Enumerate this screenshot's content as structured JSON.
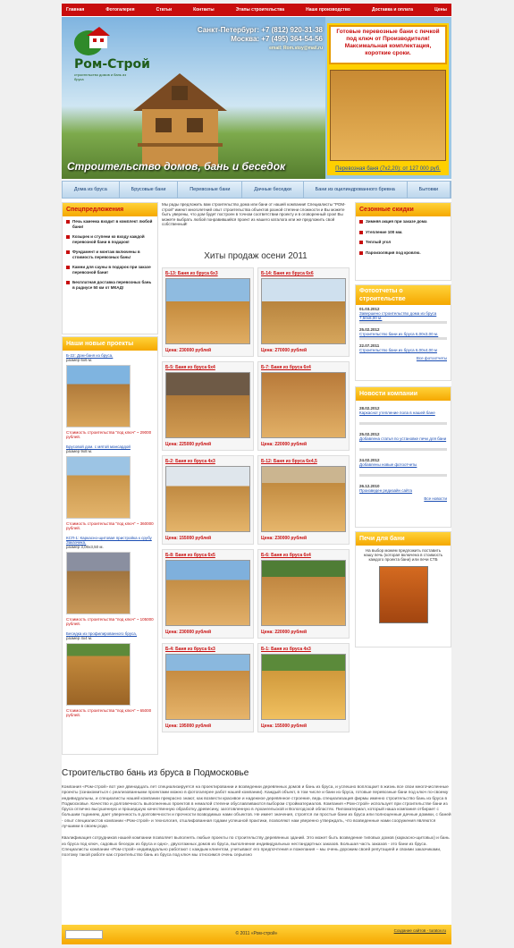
{
  "nav": [
    "Главная",
    "Фотогалерея",
    "Статьи",
    "Контакты",
    "Этапы строительства",
    "Наше производство",
    "Доставка и оплата",
    "Цены"
  ],
  "logo": {
    "title": "Ром-Строй",
    "subtitle": "строительство домов и бань из бруса"
  },
  "contacts": {
    "spb": "Санкт-Петербург: +7 (812) 920-31-38",
    "msk": "Москва: +7 (495) 364-54-56",
    "email": "email: Rom.stoy@mail.ru"
  },
  "slogan": "Строительство домов, бань и беседок",
  "promo": {
    "text": "Готовые перевозные бани с печкой под ключ от Производителя!Максимальная комплектация, короткие сроки.",
    "caption": "Перевозная баня (7x2,20): от 127 000 руб."
  },
  "categories": [
    "Дома из бруса",
    "Брусовые бани",
    "Перевозные бани",
    "Дачные беседки",
    "Бани из оцилиндрованного бревна",
    "Бытовки"
  ],
  "offers": {
    "title": "Спецпредложения",
    "items": [
      "Печь каменка входит в комплект любой бани!",
      "Козырек и ступени ко входу каждой перевозной бани в подарок!",
      "Фундамент и монтаж включены в стоимость перевозных бань!",
      "Камни для сауны в подарок при заказе перевозной бани!",
      "Бесплатная доставка перевозных бань в радиусе 50 км от МКАД!"
    ]
  },
  "projects": {
    "title": "Наши новые проекты",
    "items": [
      {
        "name": "Б-22: Дом-баня из бруса,",
        "size": "размер 6х6 м.",
        "cost": "Стоимость строительства \"под ключ\" ~ 29000 рублей."
      },
      {
        "name": "Брусовой дом. с мятой мансардой",
        "size": "размер 9х8 м.",
        "cost": "Стоимость строительства \"под ключ\" ~ 360000 рублей."
      },
      {
        "name": "КСП-1: Каркасно-щитовая пристройка к срубу Заказчика,",
        "size": "размер 3,00х3,50 м.",
        "cost": "Стоимость строительства \"под ключ\" ~ 105000 рублей."
      },
      {
        "name": "Беседка из профилированного бруса,",
        "size": "размер 4х4 м.",
        "cost": "Стоимость строительства \"под ключ\" ~ 65000 рублей."
      }
    ]
  },
  "intro": "Мы рады предложить вам строительство дома или бани от нашей компании! Специалисты \"РОМ-строй\" имеют многолетний опыт строительства объектов разной степени сложности и Вы можете быть уверены, что дом будет построен в точном соответствии проекту и в оговоренный срок! Вы можете выбрать любой понравившийся проект из нашего каталога или же предложить свой собственный!",
  "sale": {
    "title": "Хиты продаж осени 2011",
    "cards": [
      {
        "title": "Б-13: Баня из бруса 6х3",
        "price": "Цена: 230000 рублей"
      },
      {
        "title": "Б-14: Баня из бруса 6х6",
        "price": "Цена: 270000 рублей"
      },
      {
        "title": "Б-5: Баня из бруса 6х4",
        "price": "Цена: 225000 рублей"
      },
      {
        "title": "Б-7: Баня из бруса 6х4",
        "price": "Цена: 220000 рублей"
      },
      {
        "title": "Б-2: Баня из бруса 4х3",
        "price": "Цена: 155000 рублей"
      },
      {
        "title": "Б-12: Баня из бруса 6х4,5",
        "price": "Цена: 230000 рублей"
      },
      {
        "title": "Б-8: Баня из бруса 6х5",
        "price": "Цена: 230000 рублей"
      },
      {
        "title": "Б-6: Баня из бруса 6х4",
        "price": "Цена: 220000 рублей"
      },
      {
        "title": "Б-4: Баня из бруса 6х3",
        "price": "Цена: 195000 рублей"
      },
      {
        "title": "Б-1: Баня из бруса 4х3",
        "price": "Цена: 155000 рублей"
      }
    ]
  },
  "discounts": {
    "title": "Сезонные скидки",
    "items": [
      "Зимняя акция при заказе дома",
      "Утепление 100 мм.",
      "Теплый угол",
      "Пароизоляция под кровлю."
    ]
  },
  "reports": {
    "title": "Фотоотчеты о строительстве",
    "items": [
      {
        "date": "01.03.2012",
        "text": "Завершено строительство дома из бруса 7,50х8,00 м."
      },
      {
        "date": "25.02.2012",
        "text": "Строительство бани из бруса 6,00х3,00 м."
      },
      {
        "date": "22.07.2011",
        "text": "Строительство бани из бруса 6,00х4,00 м"
      }
    ],
    "more": "Все фотоотчеты"
  },
  "news": {
    "title": "Новости компании",
    "items": [
      {
        "date": "28.02.2012",
        "text": "Каркасно! утепление пола в нашей бане"
      },
      {
        "date": "25.02.2012",
        "text": "Добавлена статья по установке печи для бани"
      },
      {
        "date": "24.02.2012",
        "text": "Добавлены новые фотоотчеты"
      },
      {
        "date": "26.12.2010",
        "text": "Произведен редизайн сайта"
      }
    ],
    "more": "Все новости"
  },
  "stoves": {
    "title": "Печи для бани",
    "text": "На выбор можем предложить поставить нашу печь (которая включена в стоимость каждого проекта бани) или печи СТБ"
  },
  "seo": {
    "title": "Строительство бань из бруса в Подмосковье",
    "p1": "Компания «Ром-строй» вот уже двенадцать лет специализируется на проектировании и возведении деревянных домов и бань из бруса, и успешно воплощает в жизнь все свои многочисленные проекты (ознакомиться с реализованными проектами можно в фотогалерее работ нашей компании). Каждый объект, в том числе и бани из бруса, готовые перевозные бани под ключ по-своему индивидуальны, и специалисты нашей компании прекрасно знают, как возвести красивое и надежное деревянное строение, ведь специализация фирмы именно строительство бань из бруса в Подмосковье. Качество и долговечность выполненных проектов в немалой степени обуславливаются выбором стройматериалов. Компания «Ром-строй» использует при строительстве бани из бруса отлично высушенную и прошедшую качественную обработку древесину, заготовленную в Архангельской и Вологодской областях. Пиломатериал, который наша компания отбирает с большим тщанием, дает уверенность в долговечности и прочности возводимых нами объектов. Не имеет значения, строятся ли простые бани из бруса или полноценные дачные домики, с баней - опыт специалистов компании «Ром-строй» и технология, отшлифованная годами успешной практики, позволяют нам уверенно утверждать, что возведенные нами сооружения являются лучшими в своем роде.",
    "p2": "Квалификация сотрудников нашей компании позволяет выполнять любые проекты по строительству деревянных зданий. Это может быть возведение типовых домов (каркасно-щитовых) и бань из бруса под ключ, садовых беседок из бруса и одно-, двухэтажных домов из бруса, выполнение индивидуальных нестандартных заказов. Большая часть заказов - это бани из бруса. Специалисты компании «Ром-строй» индивидуально работают с каждым клиентом, учитывают его предпочтения и пожелания – мы очень дорожим своей репутацией и своими заказчиками, поэтому такой работе как строительство бань из бруса под ключ мы относимся очень серьезно"
  },
  "footer": {
    "search": "",
    "copyright": "© 2011 «Ром-строй»",
    "made": "Создание сайтов - turatov.ru"
  },
  "colors": {
    "red": "#c80d0d",
    "yellow": "#f5a800",
    "link": "#1a4db3"
  }
}
